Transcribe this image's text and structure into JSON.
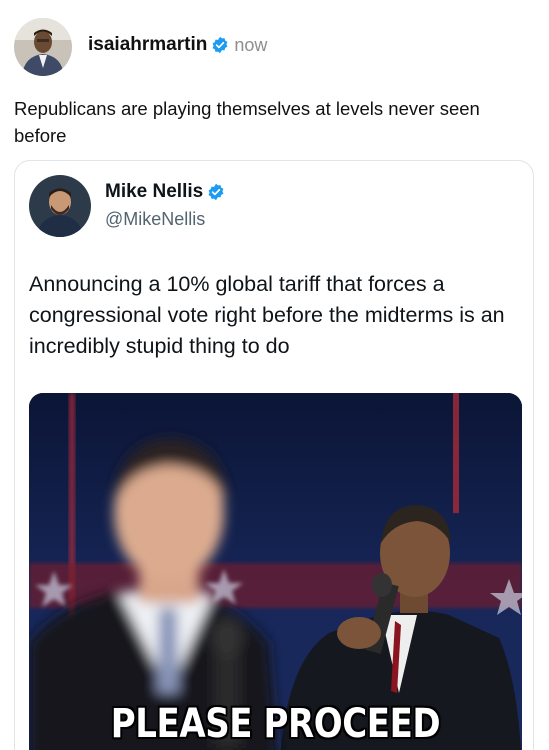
{
  "post": {
    "username": "isaiahrmartin",
    "time": "now",
    "text": "Republicans are playing themselves at levels never seen before"
  },
  "quote": {
    "name": "Mike Nellis",
    "handle": "@MikeNellis",
    "text": "Announcing a 10% global tariff that forces a congressional vote right before the midterms is an incredibly stupid thing to do",
    "meme_caption": "PLEASE PROCEED"
  },
  "colors": {
    "verified": "#1d9bf0",
    "meme_background": "#0d1a3d"
  },
  "icons": {
    "verified": "verified-badge-icon"
  }
}
